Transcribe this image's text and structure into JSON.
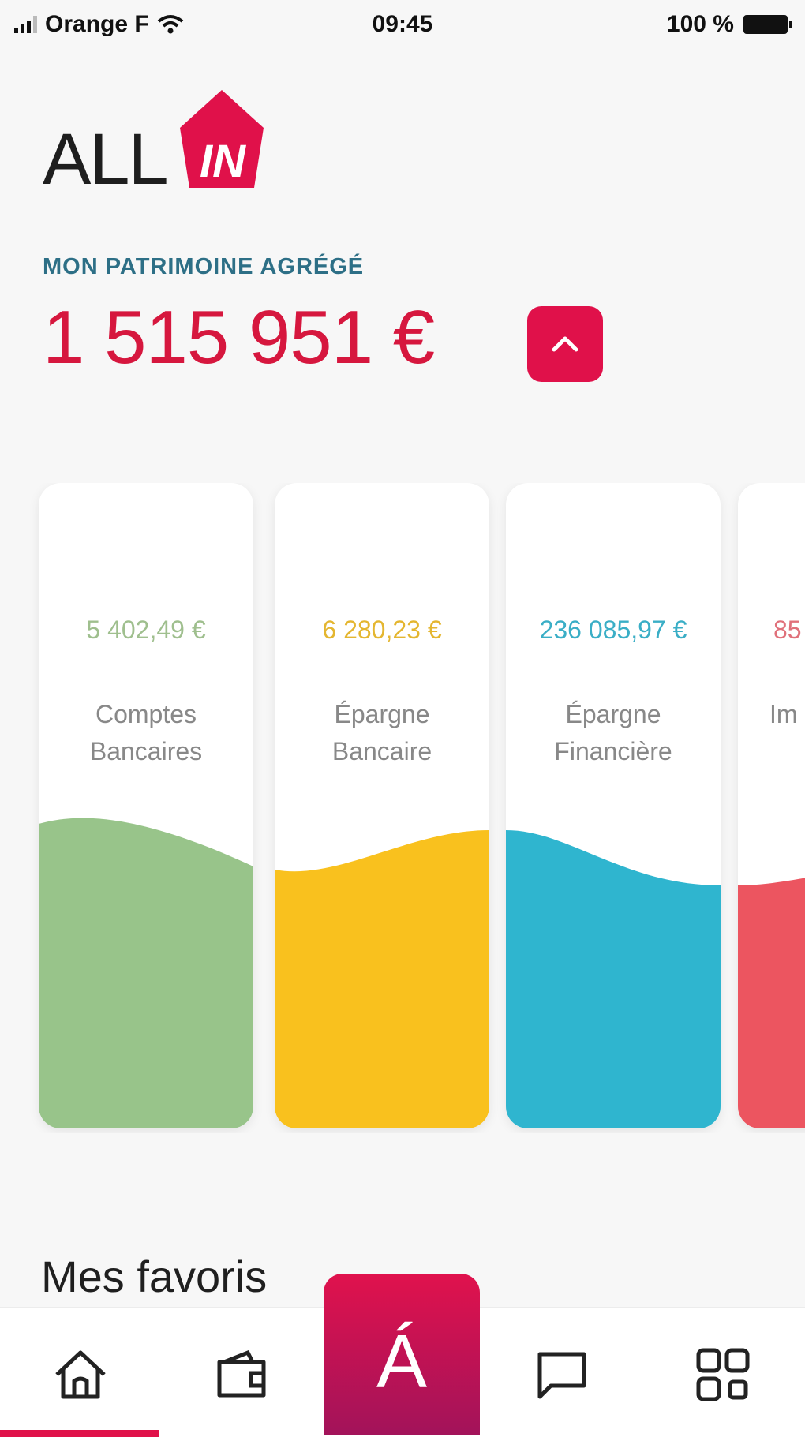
{
  "status_bar": {
    "carrier": "Orange F",
    "time": "09:45",
    "battery": "100 %"
  },
  "brand": {
    "logo_text": "ALL",
    "logo_mark": "IN",
    "accent": "#e0114a"
  },
  "header": {
    "subtitle": "MON PATRIMOINE AGRÉGÉ",
    "total": "1 515 951 €"
  },
  "cards": [
    {
      "amount": "5 402,49 €",
      "label_line1": "Comptes",
      "label_line2": "Bancaires",
      "color": "#98c48a",
      "text_color": "#9fbf8e"
    },
    {
      "amount": "6 280,23 €",
      "label_line1": "Épargne",
      "label_line2": "Bancaire",
      "color": "#f9c11e",
      "text_color": "#e4b630"
    },
    {
      "amount": "236 085,97 €",
      "label_line1": "Épargne",
      "label_line2": "Financière",
      "color": "#2fb5cf",
      "text_color": "#3aaec6"
    },
    {
      "amount": "85",
      "label_line1": "Im",
      "label_line2": "",
      "color": "#ec5560",
      "text_color": "#e0707a"
    }
  ],
  "favorites": {
    "title": "Mes favoris"
  },
  "nav": {
    "items": [
      "home-icon",
      "wallet-icon",
      "allin-icon",
      "chat-icon",
      "apps-icon"
    ],
    "center_glyph": "Á"
  }
}
